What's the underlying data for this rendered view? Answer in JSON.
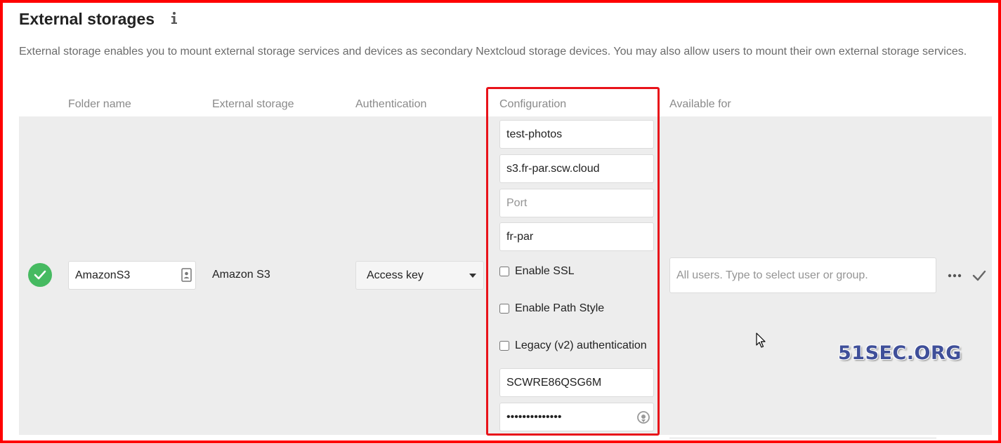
{
  "section": {
    "title": "External storages",
    "description": "External storage enables you to mount external storage services and devices as secondary Nextcloud storage devices. You may also allow users to mount their own external storage services."
  },
  "table": {
    "columns": [
      "Folder name",
      "External storage",
      "Authentication",
      "Configuration",
      "Available for"
    ]
  },
  "mount": {
    "status": "ok",
    "folder_name": "AmazonS3",
    "external_storage": "Amazon S3",
    "authentication": "Access key",
    "configuration": {
      "bucket": "test-photos",
      "hostname": "s3.fr-par.scw.cloud",
      "port_placeholder": "Port",
      "region": "fr-par",
      "enable_ssl_label": "Enable SSL",
      "enable_path_style_label": "Enable Path Style",
      "legacy_auth_label": "Legacy (v2) authentication",
      "access_key": "SCWRE86QSG6M",
      "secret_key": "••••••••••••••"
    },
    "available_for_placeholder": "All users. Type to select user or group."
  },
  "watermark": "51SEC.ORG",
  "colors": {
    "success": "#46ba61",
    "highlight_border": "#e8131a",
    "row_background": "#ededed"
  }
}
